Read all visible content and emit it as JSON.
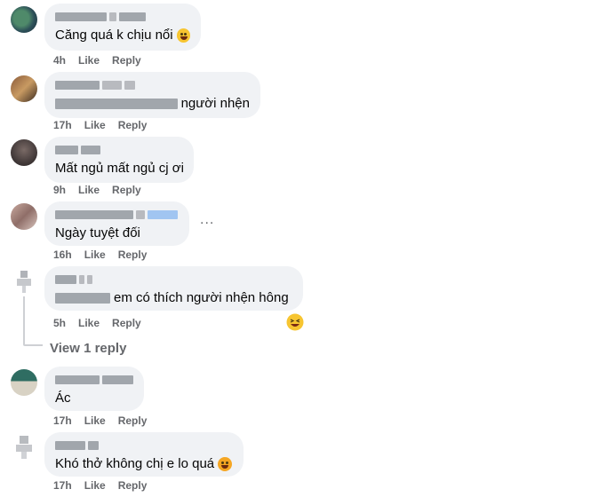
{
  "comments": [
    {
      "text": "Căng quá k chịu nổi",
      "time": "4h",
      "like": "Like",
      "reply": "Reply"
    },
    {
      "text": "người nhện",
      "time": "17h",
      "like": "Like",
      "reply": "Reply"
    },
    {
      "text": "Mất ngủ mất ngủ cj ơi",
      "time": "9h",
      "like": "Like",
      "reply": "Reply"
    },
    {
      "text": "Ngày tuyệt đối",
      "time": "16h",
      "like": "Like",
      "reply": "Reply"
    },
    {
      "text": "em có thích người nhện hông",
      "time": "5h",
      "like": "Like",
      "reply": "Reply"
    },
    {
      "text": "Ác",
      "time": "17h",
      "like": "Like",
      "reply": "Reply"
    },
    {
      "text": "Khó thở không chị e lo quá",
      "time": "17h",
      "like": "Like",
      "reply": "Reply"
    }
  ],
  "view_reply_label": "View 1 reply",
  "more_label": "...",
  "colors": {
    "bubble": "#f0f2f5",
    "meta": "#65676b",
    "text": "#050505"
  }
}
